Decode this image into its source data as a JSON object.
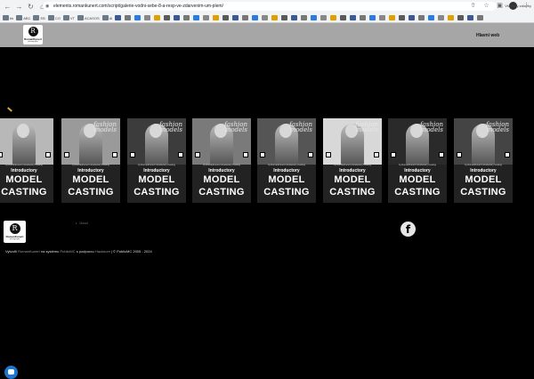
{
  "browser": {
    "url": "elements.romankunert.com/script/galerie-vodni-sebe-8-a-resp-ve-zdarvenim-um-plem/",
    "back_icon": "back-arrow-icon",
    "forward_icon": "forward-arrow-icon",
    "reload_icon": "reload-icon",
    "bookmarks": [
      "bk",
      "ABC",
      "EB",
      "CO",
      "VT",
      "ACASOS",
      "AI"
    ],
    "other_bookmarks": "Všechny záložky"
  },
  "header": {
    "logo_letter": "R",
    "logo_text": "RomanKunert",
    "logo_sub": "photography",
    "nav_main": "Hlavní web"
  },
  "gallery": {
    "cards": [
      {
        "intro": "Introductory",
        "line1": "MODEL",
        "line2": "CASTING",
        "mag": "",
        "tiny": "by RomanKunert Introductory Casting",
        "bg": "#b8b8b8"
      },
      {
        "intro": "Introductory",
        "line1": "MODEL",
        "line2": "CASTING",
        "mag": "fashion\nmodels",
        "tiny": "by RomanKunert Introductory Casting",
        "bg": "#9a9a9a"
      },
      {
        "intro": "Introductory",
        "line1": "MODEL",
        "line2": "CASTING",
        "mag": "fashion\nmodels",
        "tiny": "by RomanKunert Introductory Casting",
        "bg": "#3c3c3c"
      },
      {
        "intro": "Introductory",
        "line1": "MODEL",
        "line2": "CASTING",
        "mag": "fashion\nmodels",
        "tiny": "by RomanKunert Introductory Casting",
        "bg": "#7a7a7a"
      },
      {
        "intro": "Introductory",
        "line1": "MODEL",
        "line2": "CASTING",
        "mag": "fashion\nmodels",
        "tiny": "by RomanKunert Introductory Casting",
        "bg": "#555555"
      },
      {
        "intro": "Introductory",
        "line1": "MODEL",
        "line2": "CASTING",
        "mag": "fashion\nmodels",
        "tiny": "by RomanKunert Introductory Casting",
        "bg": "#d8d8d8"
      },
      {
        "intro": "Introductory",
        "line1": "MODEL",
        "line2": "CASTING",
        "mag": "fashion\nmodels",
        "tiny": "by RomanKunert Introductory Casting",
        "bg": "#2a2a2a"
      },
      {
        "intro": "Introductory",
        "line1": "MODEL",
        "line2": "CASTING",
        "mag": "fashion\nmodels",
        "tiny": "by RomanKunert Introductory Casting",
        "bg": "#444444"
      }
    ]
  },
  "list": {
    "item": "Úvod"
  },
  "social": {
    "facebook_icon": "facebook-icon",
    "facebook_glyph": "f"
  },
  "footer": {
    "logo_letter": "R",
    "logo_text": "RomanKunert",
    "logo_sub": "photography",
    "prefix": "Vytvořil",
    "author": "RomanKunert",
    "mid1": "na systému",
    "system": "PublicMC",
    "mid2": "s podporou",
    "support": "Hacknum",
    "suffix": "| © PublicMC 2005 - 2024"
  }
}
